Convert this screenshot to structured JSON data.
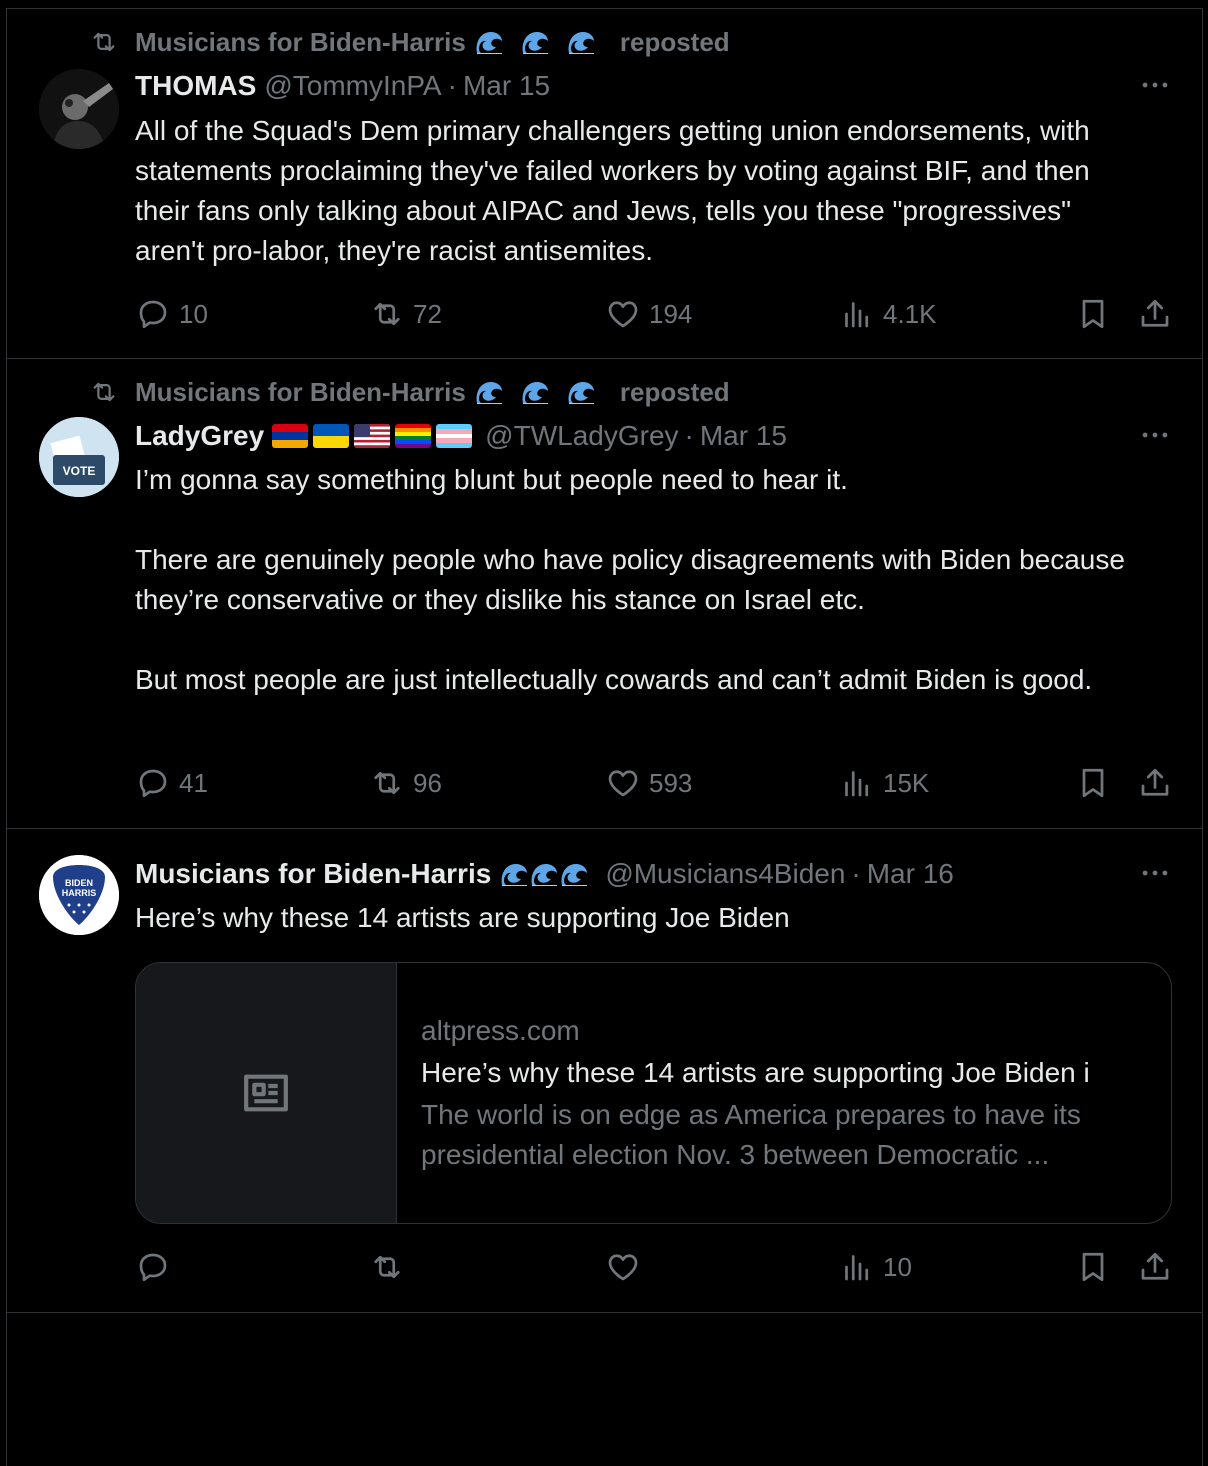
{
  "tweets": [
    {
      "repost_by": "Musicians for Biden-Harris",
      "repost_label": "reposted",
      "name": "THOMAS",
      "handle": "@TommyInPA",
      "sep": "·",
      "date": "Mar 15",
      "text": "All of the Squad's Dem primary challengers getting union endorsements, with statements proclaiming they've failed workers by voting against BIF, and then their fans only talking about AIPAC and Jews, tells you these \"progressives\" aren't pro-labor, they're racist antisemites.",
      "replies": "10",
      "reposts": "72",
      "likes": "194",
      "views": "4.1K"
    },
    {
      "repost_by": "Musicians for Biden-Harris",
      "repost_label": "reposted",
      "name": "LadyGrey",
      "handle": "@TWLadyGrey",
      "sep": "·",
      "date": "Mar 15",
      "avatar_text": "VOTE",
      "text": "I’m gonna say something blunt but people need to hear it.\n\nThere are genuinely people who have policy disagreements with Biden because they’re conservative or they dislike his stance on Israel etc.\n\nBut most people are just intellectually cowards and can’t admit Biden is good.",
      "replies": "41",
      "reposts": "96",
      "likes": "593",
      "views": "15K"
    },
    {
      "name": "Musicians for Biden-Harris",
      "handle": "@Musicians4Biden",
      "sep": "·",
      "date": "Mar 16",
      "avatar_text_1": "BIDEN",
      "avatar_text_2": "HARRIS",
      "text": "Here’s why these 14 artists are supporting Joe Biden",
      "card": {
        "domain": "altpress.com",
        "title": "Here’s why these 14 artists are supporting Joe Biden i",
        "description": "The world is on edge as America prepares to have its presidential election Nov. 3 between Democratic ..."
      },
      "views": "10"
    }
  ],
  "icons": {
    "repost": "repost-icon",
    "reply": "reply-icon",
    "like": "heart-icon",
    "views": "views-icon",
    "bookmark": "bookmark-icon",
    "share": "share-icon",
    "more": "more-icon",
    "wave": "water-wave-emoji",
    "article": "article-icon"
  },
  "colors": {
    "background": "#000000",
    "text": "#e7e9ea",
    "muted": "#71767b",
    "border": "#2f3336",
    "wave": "#5ea6e8"
  }
}
